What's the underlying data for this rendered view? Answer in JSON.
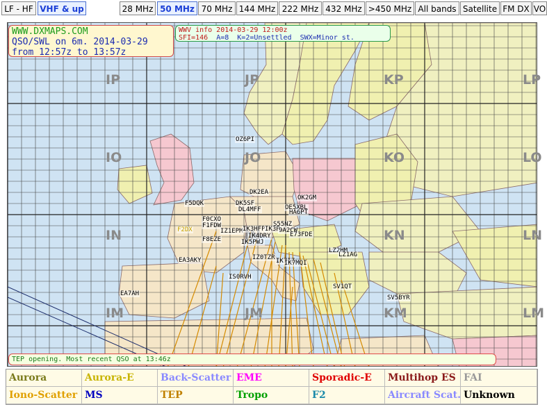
{
  "tabs": [
    {
      "label": "LF - HF",
      "active": false
    },
    {
      "label": "VHF & up",
      "active": true
    },
    {
      "label": "28 MHz",
      "active": false
    },
    {
      "label": "50 MHz",
      "active": true
    },
    {
      "label": "70 MHz",
      "active": false
    },
    {
      "label": "144 MHz",
      "active": false
    },
    {
      "label": "222 MHz",
      "active": false
    },
    {
      "label": "432 MHz",
      "active": false
    },
    {
      "label": ">450 MHz",
      "active": false
    },
    {
      "label": "All bands",
      "active": false
    },
    {
      "label": "Satellite",
      "active": false
    },
    {
      "label": "FM DX",
      "active": false
    },
    {
      "label": "VO",
      "active": false
    }
  ],
  "info": {
    "site": "WWW.DXMAPS.COM",
    "line2": "QSO/SWL on 6m. 2014-03-29",
    "line3": "from 12:57z to 13:57z"
  },
  "wwv": {
    "title": "WWV info 2014-03-29 12:00z",
    "sfi": "SFI=146",
    "a": "A=8",
    "k": "K=2=Unsettled",
    "swx": "SWX=Minor st."
  },
  "grid_labels": [
    "IP",
    "JP",
    "KP",
    "LP",
    "IO",
    "JO",
    "KO",
    "LO",
    "IN",
    "JN",
    "KN",
    "LN",
    "IM",
    "JM",
    "KM",
    "LM"
  ],
  "callsigns": [
    "OZ6PI",
    "DK2EA",
    "OK2GM",
    "DK5SF",
    "OE5XBL",
    "F5DQK",
    "DL4MFF",
    "HA6PT",
    "F0CXO",
    "F1FDW",
    "IZ1EPM",
    "IK3HFP",
    "S55NZ",
    "IK3P",
    "9A2CW",
    "F8EZE",
    "IK4DRY",
    "E73FDE",
    "IK5PWJ",
    "F2DX",
    "IZ0TZR",
    "IK7IZ",
    "IK7MQI",
    "LZ2HM",
    "EA3AKY",
    "LZ1AG",
    "IS0RVH",
    "SV1QT",
    "EA7AH",
    "SV5BYR"
  ],
  "status_text": "TEP opening. Most recent QSO at 13:46z",
  "legend": [
    {
      "label": "Aurora",
      "color": "#7a7a1a"
    },
    {
      "label": "Aurora-E",
      "color": "#c8b400"
    },
    {
      "label": "Back-Scatter",
      "color": "#8a8aff"
    },
    {
      "label": "EME",
      "color": "#ff00ff"
    },
    {
      "label": "Sporadic-E",
      "color": "#e00000"
    },
    {
      "label": "Multihop ES",
      "color": "#8a1a1a"
    },
    {
      "label": "FAI",
      "color": "#999999"
    },
    {
      "label": "Iono-Scatter",
      "color": "#e0a000"
    },
    {
      "label": "MS",
      "color": "#0000c0"
    },
    {
      "label": "TEP",
      "color": "#c08000"
    },
    {
      "label": "Tropo",
      "color": "#00a000"
    },
    {
      "label": "F2",
      "color": "#1a8aaa"
    },
    {
      "label": "Aircraft Scat.",
      "color": "#8a8aff"
    },
    {
      "label": "Unknown",
      "color": "#000000"
    }
  ],
  "colors": {
    "sea": "#cfe3f3",
    "land_a": "#f5e6c8",
    "land_b": "#f0f0b0",
    "land_c": "#f6c8d0",
    "land_d": "#f0f0c0",
    "grid": "#444444",
    "tep_path": "#d48a00"
  }
}
